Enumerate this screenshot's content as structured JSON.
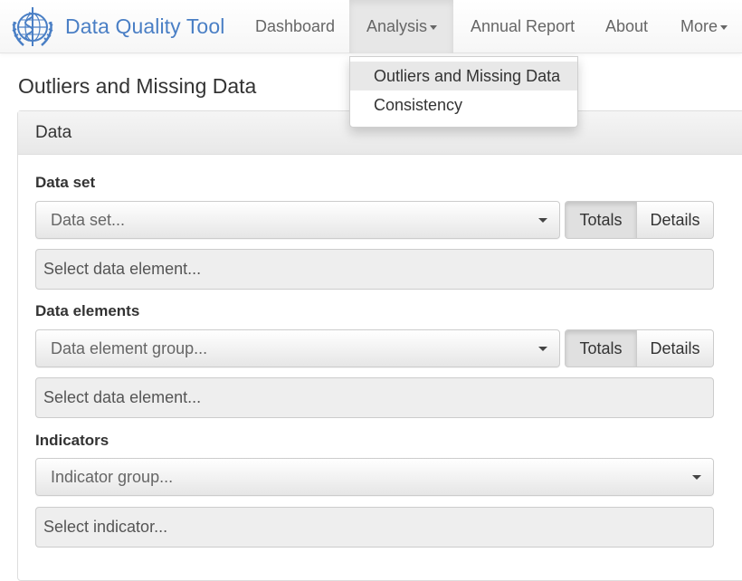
{
  "navbar": {
    "brand": "Data Quality Tool",
    "items": [
      {
        "label": "Dashboard"
      },
      {
        "label": "Analysis",
        "active": true,
        "has_caret": true
      },
      {
        "label": "Annual Report"
      },
      {
        "label": "About"
      },
      {
        "label": "More",
        "has_caret": true
      }
    ],
    "colors": {
      "brand": "#4a7fc5",
      "nav_text": "#666666",
      "active_bg": "#e7e7e7"
    }
  },
  "dropdown": {
    "items": [
      {
        "label": "Outliers and Missing Data",
        "highlighted": true
      },
      {
        "label": "Consistency"
      }
    ]
  },
  "page": {
    "title": "Outliers and Missing Data",
    "panel_title": "Data"
  },
  "sections": {
    "data_set": {
      "label": "Data set",
      "select_placeholder": "Data set...",
      "toggle_left": "Totals",
      "toggle_right": "Details",
      "input_placeholder": "Select data element..."
    },
    "data_elements": {
      "label": "Data elements",
      "select_placeholder": "Data element group...",
      "toggle_left": "Totals",
      "toggle_right": "Details",
      "input_placeholder": "Select data element..."
    },
    "indicators": {
      "label": "Indicators",
      "select_placeholder": "Indicator group...",
      "input_placeholder": "Select indicator..."
    }
  }
}
